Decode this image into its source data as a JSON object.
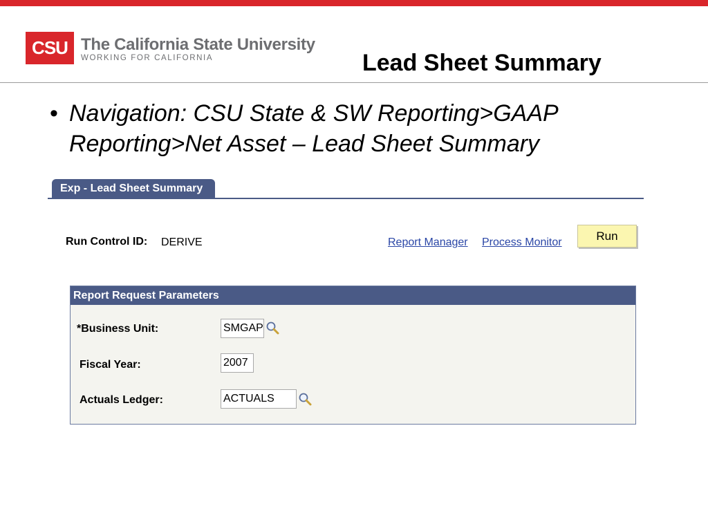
{
  "logo": {
    "mark": "CSU",
    "name": "The California State University",
    "tagline": "WORKING FOR CALIFORNIA",
    "color": "#d9262b"
  },
  "slide": {
    "title": "Lead Sheet Summary",
    "bullet": "Navigation:  CSU State & SW Reporting>GAAP Reporting>Net Asset – Lead Sheet Summary"
  },
  "page": {
    "tab_label": "Exp - Lead Sheet Summary",
    "run_control": {
      "label": "Run Control ID:",
      "value": "DERIVE"
    },
    "links": {
      "report_manager": "Report Manager",
      "process_monitor": "Process Monitor"
    },
    "run_button": "Run",
    "group": {
      "title": "Report Request Parameters",
      "fields": {
        "business_unit": {
          "label": "*Business Unit:",
          "value": "SMGAP",
          "icon": "lookup-icon"
        },
        "fiscal_year": {
          "label": "Fiscal Year:",
          "value": "2007"
        },
        "actuals_ledger": {
          "label": "Actuals Ledger:",
          "value": "ACTUALS",
          "icon": "lookup-icon"
        }
      }
    },
    "accent_color": "#4a5a86",
    "link_color": "#2a46a6"
  }
}
